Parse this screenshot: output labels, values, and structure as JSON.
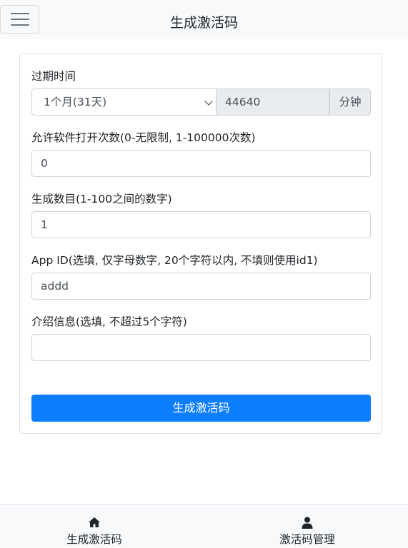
{
  "header": {
    "title": "生成激活码"
  },
  "form": {
    "expiry": {
      "label": "过期时间",
      "selected": "1个月(31天)",
      "minutes_value": "44640",
      "unit": "分钟"
    },
    "open_count": {
      "label": "允许软件打开次数(0-无限制, 1-100000次数)",
      "value": "0"
    },
    "generate_count": {
      "label": "生成数目(1-100之间的数字)",
      "value": "1"
    },
    "app_id": {
      "label": "App ID(选填, 仅字母数字, 20个字符以内, 不填则使用id1)",
      "value": "addd"
    },
    "intro": {
      "label": "介绍信息(选填, 不超过5个字符)",
      "value": ""
    },
    "submit_label": "生成激活码"
  },
  "footer": {
    "items": [
      {
        "label": "生成激活码",
        "icon": "home-icon"
      },
      {
        "label": "激活码管理",
        "icon": "user-icon"
      }
    ]
  }
}
